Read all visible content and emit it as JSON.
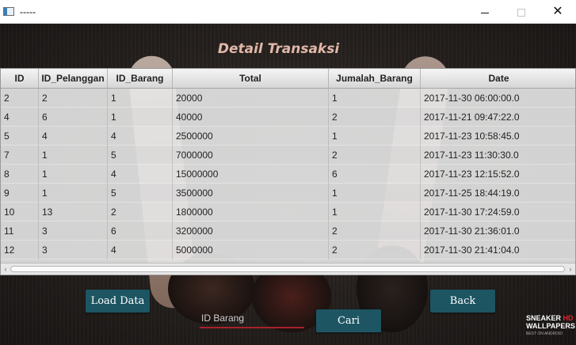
{
  "window": {
    "title": "-----",
    "min_glyph": "",
    "max_glyph": "",
    "close_glyph": "✕"
  },
  "page": {
    "title": "Detail Transaksi"
  },
  "table": {
    "columns": [
      "ID",
      "ID_Pelanggan",
      "ID_Barang",
      "Total",
      "Jumalah_Barang",
      "Date"
    ],
    "rows": [
      [
        "2",
        "2",
        "1",
        "20000",
        "1",
        "2017-11-30 06:00:00.0"
      ],
      [
        "4",
        "6",
        "1",
        "40000",
        "2",
        "2017-11-21 09:47:22.0"
      ],
      [
        "5",
        "4",
        "4",
        "2500000",
        "1",
        "2017-11-23 10:58:45.0"
      ],
      [
        "7",
        "1",
        "5",
        "7000000",
        "2",
        "2017-11-23 11:30:30.0"
      ],
      [
        "8",
        "1",
        "4",
        "15000000",
        "6",
        "2017-11-23 12:15:52.0"
      ],
      [
        "9",
        "1",
        "5",
        "3500000",
        "1",
        "2017-11-25 18:44:19.0"
      ],
      [
        "10",
        "13",
        "2",
        "1800000",
        "1",
        "2017-11-30 17:24:59.0"
      ],
      [
        "11",
        "3",
        "6",
        "3200000",
        "2",
        "2017-11-30 21:36:01.0"
      ],
      [
        "12",
        "3",
        "4",
        "5000000",
        "2",
        "2017-11-30 21:41:04.0"
      ]
    ],
    "scroll_left_glyph": "‹",
    "scroll_right_glyph": "›"
  },
  "buttons": {
    "load": "Load Data",
    "back": "Back",
    "cari": "Cari"
  },
  "search": {
    "placeholder": "ID Barang",
    "value": ""
  },
  "brand": {
    "line1a": "SNEAKER",
    "line1b": "HD",
    "line2": "WALLPAPERS",
    "line3": "BEST ON ANDROID"
  },
  "colors": {
    "button_bg": "#1d5563",
    "title_text": "#e0b7a8",
    "input_underline": "#a8212b"
  }
}
